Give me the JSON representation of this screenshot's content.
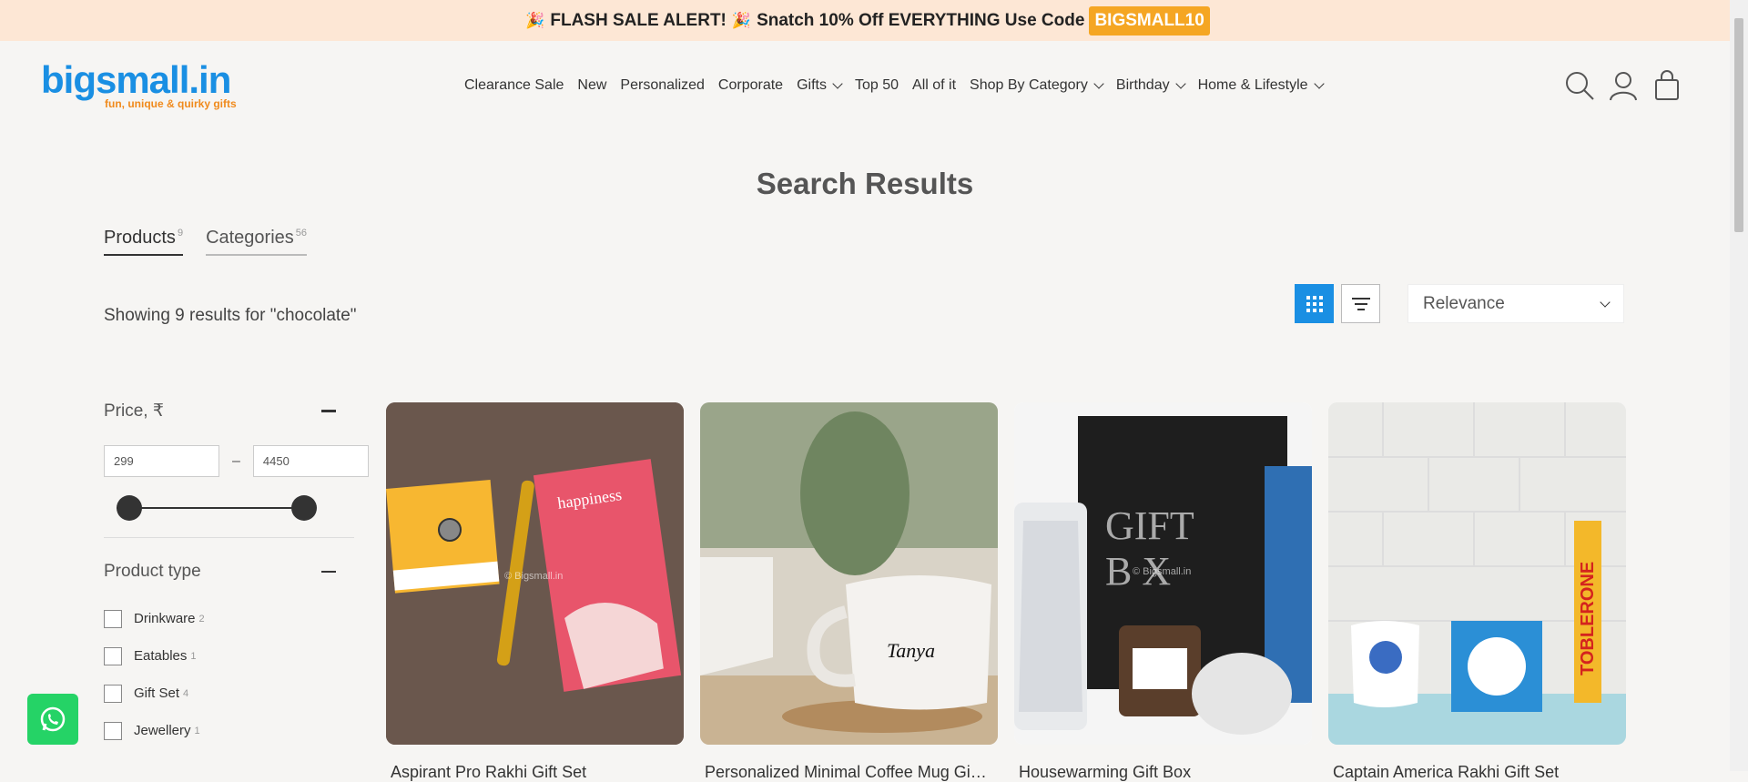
{
  "announcement": {
    "emoji": "🎉",
    "text_part1": "FLASH SALE ALERT!",
    "text_part2": "Snatch 10% Off EVERYTHING Use Code",
    "code": "BIGSMALL10",
    "background": "#fde7d5",
    "code_color": "#f5a623"
  },
  "header": {
    "logo": {
      "main": "bigsmall.in",
      "tagline": "fun, unique & quirky gifts",
      "color": "#1a8fe3",
      "tagline_color": "#f08a1c"
    },
    "nav": [
      {
        "label": "Clearance Sale",
        "dropdown": false
      },
      {
        "label": "New",
        "dropdown": false
      },
      {
        "label": "Personalized",
        "dropdown": false
      },
      {
        "label": "Corporate",
        "dropdown": false
      },
      {
        "label": "Gifts",
        "dropdown": true
      },
      {
        "label": "Top 50",
        "dropdown": false
      },
      {
        "label": "All of it",
        "dropdown": false
      },
      {
        "label": "Shop By Category",
        "dropdown": true
      },
      {
        "label": "Birthday",
        "dropdown": true
      },
      {
        "label": "Home & Lifestyle",
        "dropdown": true
      }
    ],
    "icons": [
      "search-icon",
      "account-icon",
      "cart-icon"
    ]
  },
  "page": {
    "title": "Search Results",
    "tabs": [
      {
        "label": "Products",
        "count": "9",
        "active": true
      },
      {
        "label": "Categories",
        "count": "56",
        "active": false
      }
    ],
    "showing": "Showing 9 results for \"chocolate\"",
    "sort": {
      "selected": "Relevance"
    },
    "accent": "#1a8fe3"
  },
  "filters": {
    "price": {
      "label": "Price, ₹",
      "min": "299",
      "max": "4450",
      "range_min": 0.0,
      "range_max": 1.0
    },
    "product_type": {
      "label": "Product type",
      "options": [
        {
          "label": "Drinkware",
          "count": "2"
        },
        {
          "label": "Eatables",
          "count": "1"
        },
        {
          "label": "Gift Set",
          "count": "4"
        },
        {
          "label": "Jewellery",
          "count": "1"
        }
      ]
    }
  },
  "products": [
    {
      "title": "Aspirant Pro Rakhi Gift Set",
      "watermark": "© Bigsmall.in"
    },
    {
      "title": "Personalized Minimal Coffee Mug Gift Set",
      "watermark": "",
      "mug_name": "Tanya"
    },
    {
      "title": "Housewarming Gift Box",
      "watermark": "© Bigsmall.in"
    },
    {
      "title": "Captain America Rakhi Gift Set",
      "watermark": ""
    }
  ],
  "whatsapp": {
    "icon": "whatsapp-icon",
    "color": "#25d366"
  }
}
